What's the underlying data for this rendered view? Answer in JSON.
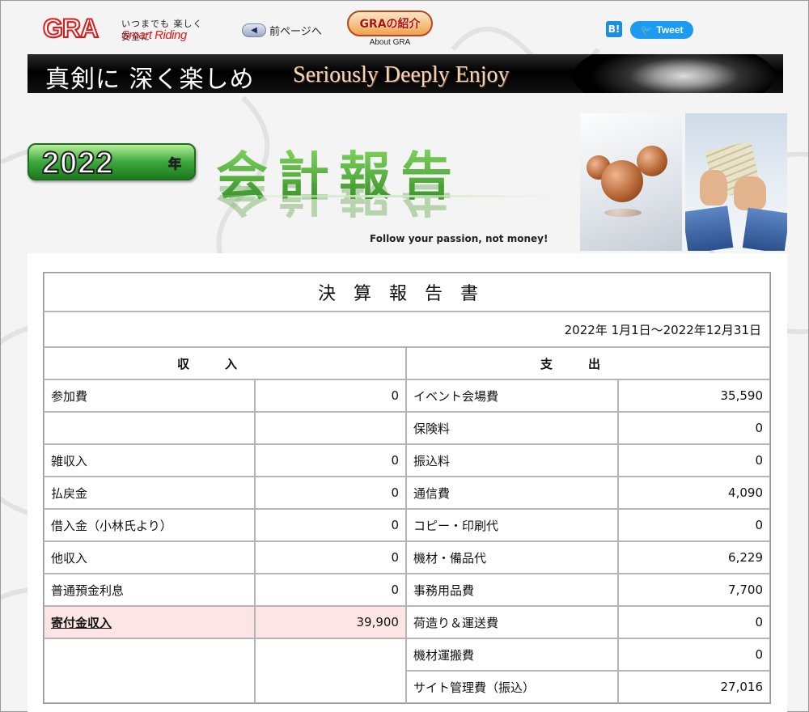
{
  "header": {
    "logo_text": "GRA",
    "logo_tagline": "いつまでも 楽しく 安全に",
    "logo_sub": "Smart Riding",
    "prev_page_label": "前ページへ",
    "about_label": "GRAの紹介",
    "about_sub": "About GRA",
    "hatena_label": "B!",
    "tweet_label": "Tweet"
  },
  "banner": {
    "slogan_jp": "真剣に 深く楽しめ",
    "slogan_en": "Seriously Deeply Enjoy"
  },
  "title": {
    "year": "2022",
    "year_suffix": "年",
    "heading": "会計報告",
    "tagline": "Follow your passion, not money!"
  },
  "report": {
    "title": "決算報告書",
    "period": "2022年 1月1日～2022年12月31日",
    "income_header": "収入",
    "expense_header": "支出",
    "rows": [
      {
        "inc_label": "参加費",
        "inc_value": "0",
        "exp_label": "イベント会場費",
        "exp_value": "35,590"
      },
      {
        "inc_label": "",
        "inc_value": "",
        "exp_label": "保険料",
        "exp_value": "0"
      },
      {
        "inc_label": "雑収入",
        "inc_value": "0",
        "exp_label": "振込料",
        "exp_value": "0"
      },
      {
        "inc_label": "払戻金",
        "inc_value": "0",
        "exp_label": "通信費",
        "exp_value": "4,090"
      },
      {
        "inc_label": "借入金（小林氏より）",
        "inc_value": "0",
        "exp_label": "コピー・印刷代",
        "exp_value": "0"
      },
      {
        "inc_label": "他収入",
        "inc_value": "0",
        "exp_label": "機材・備品代",
        "exp_value": "6,229"
      },
      {
        "inc_label": "普通預金利息",
        "inc_value": "0",
        "exp_label": "事務用品費",
        "exp_value": "7,700"
      },
      {
        "inc_label": "寄付金収入",
        "inc_value": "39,900",
        "exp_label": "荷造り＆運送費",
        "exp_value": "0"
      },
      {
        "inc_label": "",
        "inc_value": "",
        "exp_label": "機材運搬費",
        "exp_value": "0"
      },
      {
        "inc_label": "",
        "inc_value": "",
        "exp_label": "サイト管理費（振込）",
        "exp_value": "27,016"
      }
    ]
  },
  "colors": {
    "brand_red": "#e01818",
    "title_green": "#3da83d",
    "highlight_pink": "#fde5e5",
    "tweet_blue": "#1d9bf0"
  }
}
